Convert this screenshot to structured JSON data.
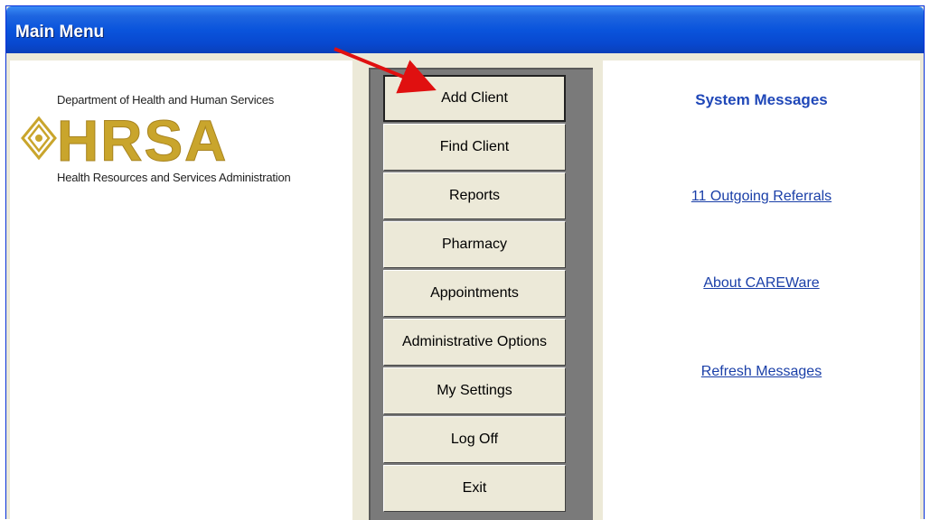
{
  "window": {
    "title": "Main Menu"
  },
  "logo": {
    "top_line": "Department of Health and Human Services",
    "wordmark": "HRSA",
    "bottom_line": "Health Resources and Services Administration",
    "colors": {
      "gold": "#c9a52c",
      "gold_light": "#e8cd5e"
    }
  },
  "menu": {
    "buttons": [
      {
        "label": "Add Client",
        "active": true
      },
      {
        "label": "Find Client"
      },
      {
        "label": "Reports"
      },
      {
        "label": "Pharmacy"
      },
      {
        "label": "Appointments"
      },
      {
        "label": "Administrative Options"
      },
      {
        "label": "My Settings"
      },
      {
        "label": "Log Off"
      },
      {
        "label": "Exit"
      }
    ]
  },
  "system_messages": {
    "title": "System Messages",
    "links": [
      {
        "label": "11  Outgoing Referrals"
      },
      {
        "label": "About CAREWare"
      },
      {
        "label": "Refresh Messages"
      }
    ]
  },
  "annotation": {
    "arrow_color": "#e01010"
  }
}
